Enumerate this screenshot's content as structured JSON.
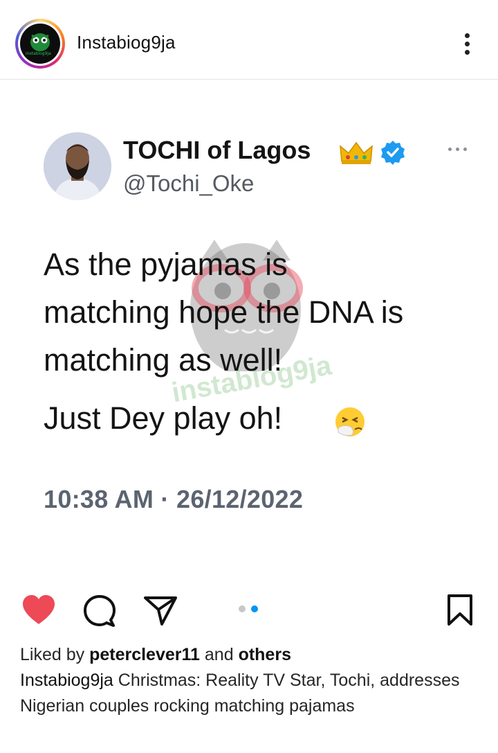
{
  "header": {
    "account_name": "Instabiog9ja",
    "avatar_text": "instablog9ja"
  },
  "tweet": {
    "display_name": "TOCHI of Lagos",
    "handle": "@Tochi_Oke",
    "lines": [
      "As the pyjamas is",
      "matching hope the DNA is",
      "matching as well!",
      "Just Dey play oh!"
    ],
    "timestamp": "10:38 AM · 26/12/2022",
    "watermark_text": "instablog9ja"
  },
  "actions": {
    "liked": true,
    "like_color": "#ed4956",
    "carousel_total": 2,
    "carousel_active": 2,
    "carousel_active_color": "#0095f6"
  },
  "caption": {
    "liked_by_prefix": "Liked by",
    "liked_by_user": "peterclever11",
    "liked_by_and": "and",
    "liked_by_others": "others",
    "author": "Instabiog9ja",
    "text": "Christmas: Reality TV Star, Tochi, addresses Nigerian couples rocking matching pajamas"
  },
  "icons": [
    "more-vertical-icon",
    "crown-icon",
    "verified-badge-icon",
    "more-horizontal-icon",
    "sneezing-face-emoji-icon",
    "heart-icon",
    "comment-icon",
    "share-icon",
    "bookmark-icon"
  ]
}
